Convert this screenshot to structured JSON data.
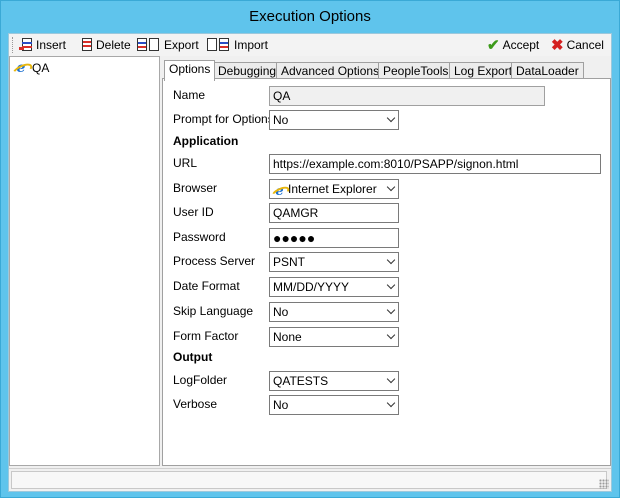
{
  "window": {
    "title": "Execution Options"
  },
  "toolbar": {
    "insert": "Insert",
    "delete": "Delete",
    "export": "Export",
    "import": "Import",
    "accept": "Accept",
    "cancel": "Cancel"
  },
  "tree": {
    "items": [
      {
        "label": "QA",
        "icon": "internet-explorer-icon"
      }
    ]
  },
  "tabs": [
    {
      "label": "Options",
      "active": true
    },
    {
      "label": "Debugging"
    },
    {
      "label": "Advanced Options"
    },
    {
      "label": "PeopleTools"
    },
    {
      "label": "Log Export"
    },
    {
      "label": "DataLoader"
    }
  ],
  "form": {
    "name": {
      "label": "Name",
      "value": "QA"
    },
    "prompt": {
      "label": "Prompt for Options",
      "value": "No"
    },
    "application_header": "Application",
    "url": {
      "label": "URL",
      "value": "https://example.com:8010/PSAPP/signon.html"
    },
    "browser": {
      "label": "Browser",
      "value": "Internet Explorer"
    },
    "userid": {
      "label": "User ID",
      "value": "QAMGR"
    },
    "password": {
      "label": "Password",
      "value": "●●●●●"
    },
    "process_server": {
      "label": "Process Server",
      "value": "PSNT"
    },
    "date_format": {
      "label": "Date Format",
      "value": "MM/DD/YYYY"
    },
    "skip_language": {
      "label": "Skip Language",
      "value": "No"
    },
    "form_factor": {
      "label": "Form Factor",
      "value": "None"
    },
    "output_header": "Output",
    "logfolder": {
      "label": "LogFolder",
      "value": "QATESTS"
    },
    "verbose": {
      "label": "Verbose",
      "value": "No"
    }
  },
  "colors": {
    "titlebar": "#5fc4ec",
    "accept": "#3c9a1a",
    "cancel": "#d42020"
  }
}
